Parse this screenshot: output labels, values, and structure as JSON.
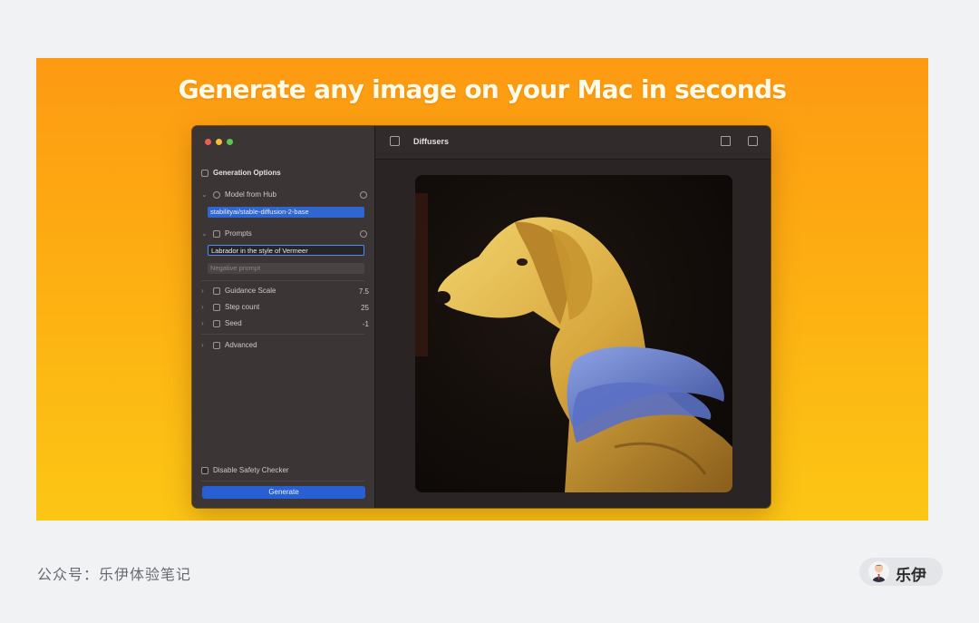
{
  "banner": {
    "headline": "Generate any image on your Mac in seconds"
  },
  "app": {
    "window_title": "Diffusers",
    "sidebar": {
      "section_title": "Generation Options",
      "model_label": "Model from Hub",
      "model_value": "stabilityai/stable-diffusion-2-base",
      "prompts_label": "Prompts",
      "prompt_value": "Labrador in the style of Vermeer",
      "negative_placeholder": "Negative prompt",
      "params": [
        {
          "label": "Guidance Scale",
          "value": "7.5"
        },
        {
          "label": "Step count",
          "value": "25"
        },
        {
          "label": "Seed",
          "value": "-1"
        }
      ],
      "advanced_label": "Advanced",
      "safety_label": "Disable Safety Checker",
      "generate_label": "Generate"
    },
    "icons": [
      "sidebar-toggle-icon",
      "share-icon",
      "save-icon",
      "gear-icon"
    ]
  },
  "footer": {
    "account_text": "公众号：乐伊体验笔记",
    "badge_name": "乐伊"
  },
  "colors": {
    "banner_top": "#fd9a12",
    "banner_bottom": "#fcc615",
    "accent_blue": "#2860d4"
  }
}
